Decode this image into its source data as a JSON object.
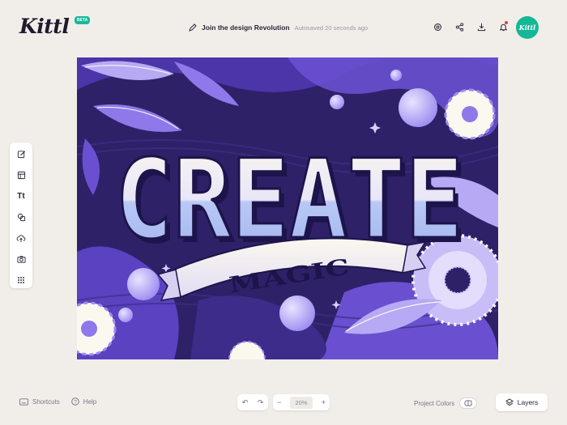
{
  "app": {
    "logo": "Kittl",
    "badge": "BETA"
  },
  "header": {
    "project_title": "Join the design Revolution",
    "autosave_status": "Autosaved 20 seconds ago",
    "icons": [
      "settings-icon",
      "share-icon",
      "download-icon",
      "notification-icon"
    ],
    "avatar_text": "Kittl"
  },
  "toolbar": {
    "tools": [
      "edit-icon",
      "templates-icon",
      "text-tool",
      "shapes-icon",
      "upload-icon",
      "camera-icon",
      "grid-icon"
    ],
    "text_tool_label": "Tt"
  },
  "canvas": {
    "headline": "CREATE",
    "banner": "MAGIC"
  },
  "footer": {
    "shortcuts_label": "Shortcuts",
    "help_label": "Help",
    "undo": "↶",
    "redo": "↷",
    "zoom_out": "−",
    "zoom_value": "20%",
    "zoom_in": "+",
    "project_colors_label": "Project Colors",
    "layers_label": "Layers"
  },
  "colors": {
    "accent": "#14b895",
    "canvas_bg": "#2e2168",
    "lavender": "#9d8cf0",
    "cream": "#f4f0e6"
  }
}
